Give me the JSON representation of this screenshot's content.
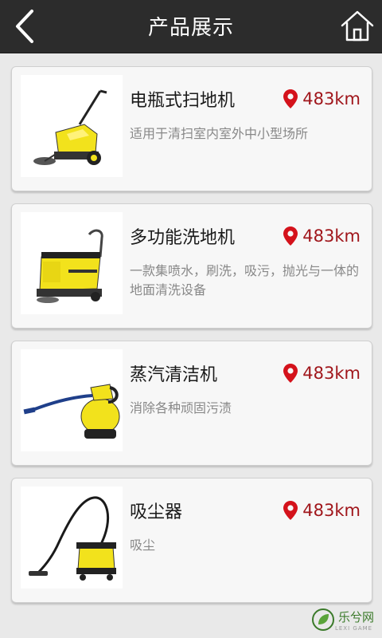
{
  "header": {
    "title": "产品展示",
    "back_icon": "chevron-left-icon",
    "home_icon": "home-icon"
  },
  "products": [
    {
      "name": "电瓶式扫地机",
      "distance": "483km",
      "description": "适用于清扫室内室外中小型场所"
    },
    {
      "name": "多功能洗地机",
      "distance": "483km",
      "description": "一款集喷水，刷洗，吸污，抛光与一体的地面清洗设备"
    },
    {
      "name": "蒸汽清洁机",
      "distance": "483km",
      "description": "消除各种顽固污渍"
    },
    {
      "name": "吸尘器",
      "distance": "483km",
      "description": "吸尘"
    }
  ],
  "watermark": {
    "text": "乐兮网",
    "sub": "LEXI GAME"
  },
  "colors": {
    "topbar": "#2c2c2c",
    "accent_red": "#d4121b",
    "distance_text": "#a0161b",
    "product_yellow": "#f2e21c"
  }
}
